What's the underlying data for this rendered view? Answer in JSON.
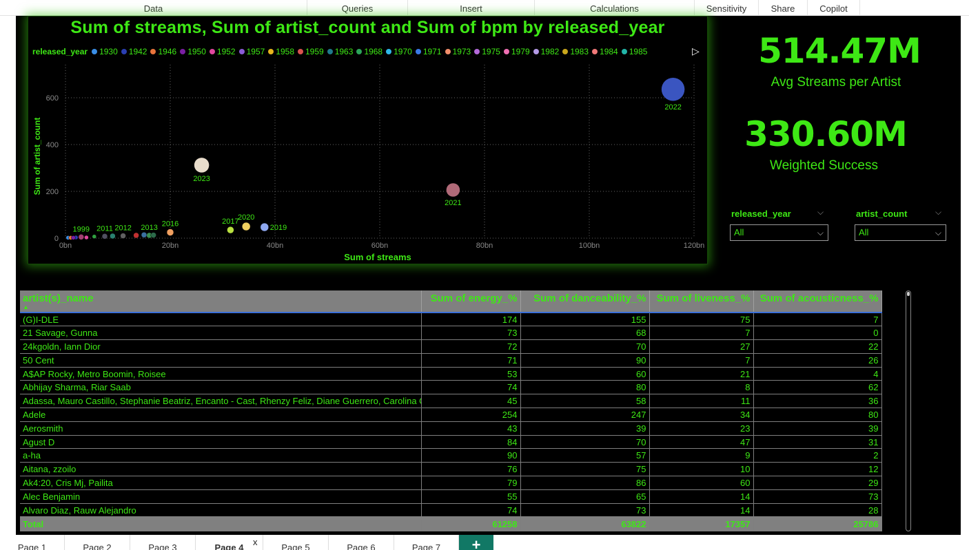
{
  "ribbon": {
    "tabs": [
      {
        "label": "Data"
      },
      {
        "label": "Queries"
      },
      {
        "label": "Insert"
      },
      {
        "label": "Calculations"
      },
      {
        "label": "Sensitivity"
      },
      {
        "label": "Share"
      },
      {
        "label": "Copilot"
      }
    ]
  },
  "chart": {
    "legend_title": "released_year",
    "legend_items": [
      {
        "label": "1930",
        "color": "#3a8ee6"
      },
      {
        "label": "1942",
        "color": "#2a3eb1"
      },
      {
        "label": "1946",
        "color": "#e8743b"
      },
      {
        "label": "1950",
        "color": "#7a1fa2"
      },
      {
        "label": "1952",
        "color": "#e0479e"
      },
      {
        "label": "1957",
        "color": "#8a5cd6"
      },
      {
        "label": "1958",
        "color": "#e6b41e"
      },
      {
        "label": "1959",
        "color": "#d9534f"
      },
      {
        "label": "1963",
        "color": "#1f7a8c"
      },
      {
        "label": "1968",
        "color": "#2ca55a"
      },
      {
        "label": "1970",
        "color": "#2fb8e8"
      },
      {
        "label": "1971",
        "color": "#3a7ae6"
      },
      {
        "label": "1973",
        "color": "#f28e6b"
      },
      {
        "label": "1975",
        "color": "#b36ad9"
      },
      {
        "label": "1979",
        "color": "#f06fb3"
      },
      {
        "label": "1982",
        "color": "#b49ae6"
      },
      {
        "label": "1983",
        "color": "#c9a61c"
      },
      {
        "label": "1984",
        "color": "#f07878"
      },
      {
        "label": "1985",
        "color": "#22b5a8"
      }
    ]
  },
  "chart_data": {
    "type": "scatter",
    "title": "Sum of streams, Sum of artist_count and Sum of bpm by released_year",
    "xlabel": "Sum of streams",
    "ylabel": "Sum of artist_count",
    "xlim": [
      0,
      120
    ],
    "ylim": [
      0,
      700
    ],
    "x_ticks": [
      {
        "v": 0,
        "label": "0bn"
      },
      {
        "v": 20,
        "label": "20bn"
      },
      {
        "v": 40,
        "label": "40bn"
      },
      {
        "v": 60,
        "label": "60bn"
      },
      {
        "v": 80,
        "label": "80bn"
      },
      {
        "v": 100,
        "label": "100bn"
      },
      {
        "v": 120,
        "label": "120bn"
      }
    ],
    "y_ticks": [
      {
        "v": 0,
        "label": "0"
      },
      {
        "v": 200,
        "label": "200"
      },
      {
        "v": 400,
        "label": "400"
      },
      {
        "v": 600,
        "label": "600"
      }
    ],
    "grid": true,
    "legend": "top",
    "x_unit": "bn",
    "size_field": "Sum of bpm",
    "points": [
      {
        "label": "2022",
        "x": 116,
        "y": 636,
        "r": 17,
        "color": "#3a55c0",
        "show_label": true
      },
      {
        "label": "2023",
        "x": 26,
        "y": 312,
        "r": 11,
        "color": "#e8dccb",
        "show_label": true
      },
      {
        "label": "2021",
        "x": 74,
        "y": 206,
        "r": 10,
        "color": "#b06a78",
        "show_label": true
      },
      {
        "label": "2019",
        "x": 38,
        "y": 47,
        "r": 6,
        "color": "#8fa8f0",
        "show_label": true
      },
      {
        "label": "2020",
        "x": 34.5,
        "y": 50,
        "r": 6,
        "color": "#f0d060",
        "show_label": true
      },
      {
        "label": "2017",
        "x": 31.5,
        "y": 35,
        "r": 5,
        "color": "#b8e040",
        "show_label": true
      },
      {
        "label": "2016",
        "x": 20,
        "y": 25,
        "r": 5,
        "color": "#f0a060",
        "show_label": true
      },
      {
        "label": "2013",
        "x": 16,
        "y": 12,
        "r": 4,
        "color": "#3a9050",
        "show_label": true
      },
      {
        "label": "2012",
        "x": 11,
        "y": 10,
        "r": 4,
        "color": "#606060",
        "show_label": true
      },
      {
        "label": "2011",
        "x": 7.5,
        "y": 8,
        "r": 4,
        "color": "#505060",
        "show_label": true
      },
      {
        "label": "1999",
        "x": 3,
        "y": 5,
        "r": 4,
        "color": "#a04070",
        "show_label": true
      },
      {
        "label": "2014",
        "x": 13.5,
        "y": 12,
        "r": 4,
        "color": "#c03030",
        "show_label": false
      },
      {
        "label": "2015",
        "x": 15,
        "y": 14,
        "r": 4,
        "color": "#3a70a0",
        "show_label": false
      },
      {
        "label": "2018",
        "x": 16.8,
        "y": 13,
        "r": 4,
        "color": "#2c6a4a",
        "show_label": false
      },
      {
        "label": "2010",
        "x": 9,
        "y": 9,
        "r": 4,
        "color": "#2a8070",
        "show_label": false
      },
      {
        "label": "2008",
        "x": 5.5,
        "y": 7,
        "r": 3,
        "color": "#30a040",
        "show_label": false
      },
      {
        "label": "2002",
        "x": 2,
        "y": 3,
        "r": 3,
        "color": "#2a3eb1",
        "show_label": false
      },
      {
        "label": "1985",
        "x": 0.5,
        "y": 2,
        "r": 3,
        "color": "#3a8ee6",
        "show_label": false
      },
      {
        "label": "1984",
        "x": 1,
        "y": 2,
        "r": 3,
        "color": "#e8743b",
        "show_label": false
      },
      {
        "label": "1983",
        "x": 1.5,
        "y": 2,
        "r": 3,
        "color": "#7a1fa2",
        "show_label": false
      },
      {
        "label": "1982",
        "x": 4,
        "y": 3,
        "r": 3,
        "color": "#e0479e",
        "show_label": false
      }
    ]
  },
  "cards": [
    {
      "value": "514.47M",
      "label": "Avg Streams per Artist"
    },
    {
      "value": "330.60M",
      "label": "Weighted Success"
    }
  ],
  "slicers": [
    {
      "title": "released_year",
      "value": "All"
    },
    {
      "title": "artist_count",
      "value": "All"
    }
  ],
  "table": {
    "columns": [
      "artist(s)_name",
      "Sum of energy_%",
      "Sum of danceability_%",
      "Sum of liveness_%",
      "Sum of acousticness_%"
    ],
    "rows": [
      [
        "(G)I-DLE",
        "174",
        "155",
        "75",
        "7"
      ],
      [
        "21 Savage, Gunna",
        "73",
        "68",
        "7",
        "0"
      ],
      [
        "24kgoldn, Iann Dior",
        "72",
        "70",
        "27",
        "22"
      ],
      [
        "50 Cent",
        "71",
        "90",
        "7",
        "26"
      ],
      [
        "A$AP Rocky, Metro Boomin, Roisee",
        "53",
        "60",
        "21",
        "4"
      ],
      [
        "Abhijay Sharma, Riar Saab",
        "74",
        "80",
        "8",
        "62"
      ],
      [
        "Adassa, Mauro Castillo, Stephanie Beatriz, Encanto - Cast, Rhenzy Feliz, Diane Guerrero, Carolina Gaitan",
        "45",
        "58",
        "11",
        "36"
      ],
      [
        "Adele",
        "254",
        "247",
        "34",
        "80"
      ],
      [
        "Aerosmith",
        "43",
        "39",
        "23",
        "39"
      ],
      [
        "Agust D",
        "84",
        "70",
        "47",
        "31"
      ],
      [
        "a-ha",
        "90",
        "57",
        "9",
        "2"
      ],
      [
        "Aitana, zzoilo",
        "76",
        "75",
        "10",
        "12"
      ],
      [
        "Ak4:20, Cris Mj, Pailita",
        "79",
        "86",
        "60",
        "29"
      ],
      [
        "Alec Benjamin",
        "55",
        "65",
        "14",
        "73"
      ],
      [
        "Alvaro Diaz, Rauw Alejandro",
        "74",
        "73",
        "14",
        "28"
      ]
    ],
    "total": [
      "Total",
      "61258",
      "63822",
      "17357",
      "25786"
    ]
  },
  "page_tabs": {
    "pages": [
      "Page 1",
      "Page 2",
      "Page 3",
      "Page 4",
      "Page 5",
      "Page 6",
      "Page 7"
    ],
    "active_index": 3,
    "close_label": "x",
    "add_label": "+"
  }
}
